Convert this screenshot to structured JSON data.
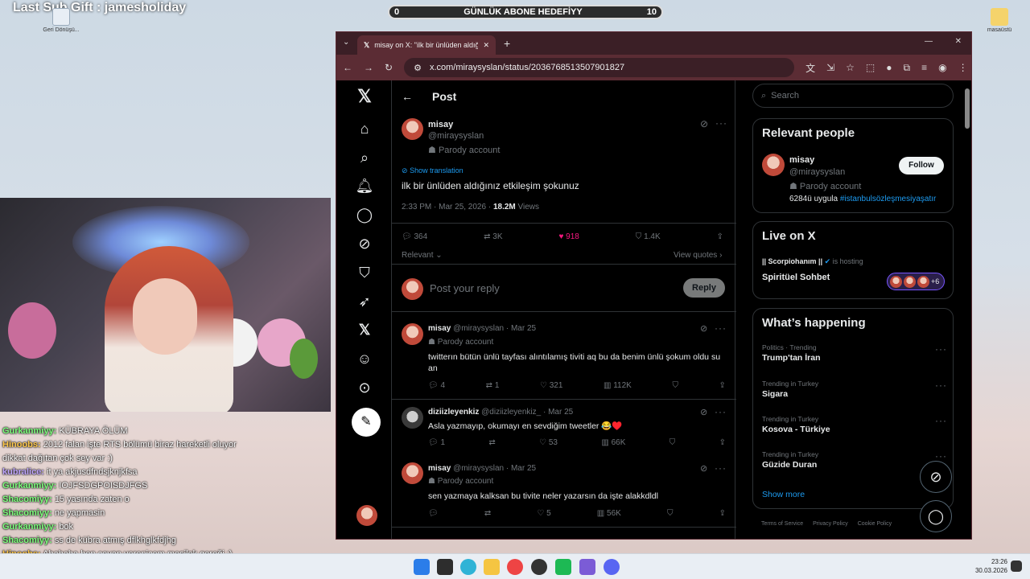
{
  "stream": {
    "last_sub_gift": "Last Sub Gift : jamesholiday",
    "goal": {
      "title": "GÜNLÜK ABONE HEDEFİYY",
      "current": "0",
      "target": "10",
      "progress": 0
    }
  },
  "desktop": {
    "recycle_label": "Geri Dönüşü...",
    "folder_label": "masaüstü"
  },
  "chat": [
    {
      "user": "Gurkanmiyy:",
      "msg": "KÜBRAYA ÖLÜM",
      "color": "#7dff7d"
    },
    {
      "user": "Hinoobs:",
      "msg": "2012 falan işte RTS bölümü biraz hareketli oluyor",
      "color": "#ffc94d"
    },
    {
      "user": "",
      "msg": "dikkat dağıtan çok sey var :)",
      "color": "#ffffff"
    },
    {
      "user": "kubralice:",
      "msg": "it ya akjusdfndsjknjkfsa",
      "color": "#c0a7ff"
    },
    {
      "user": "Gurkanmiyy:",
      "msg": "IOJFSDGPOISDJFGS",
      "color": "#7dff7d"
    },
    {
      "user": "Shacomiyy:",
      "msg": "15 yasında zaten o",
      "color": "#7dff7d"
    },
    {
      "user": "Shacomiyy:",
      "msg": "ne yapmasin",
      "color": "#7dff7d"
    },
    {
      "user": "Gurkanmiyy:",
      "msg": "bok",
      "color": "#7dff7d"
    },
    {
      "user": "Shacomiyy:",
      "msg": "ss de kübra atmış dflkhglkfdjhg",
      "color": "#7dff7d"
    },
    {
      "user": "Hinoobs:",
      "msg": "Ahahaha ben cevap verenicem mesilek gereği :)",
      "color": "#ffc94d"
    }
  ],
  "browser": {
    "tab_title": "misay on X: \"ilk bir ünlüden aldığı",
    "url": "x.com/miraysyslan/status/2036768513507901827"
  },
  "x": {
    "header_title": "Post",
    "post": {
      "name": "misay",
      "handle": "@miraysyslan",
      "parody": "Parody account",
      "show_translation": "Show translation",
      "text": "ilk bir ünlüden aldığınız etkileşim şokunuz",
      "time": "2:33 PM · Mar 25, 2026 · ",
      "views": "18.2M",
      "views_label": " Views",
      "replies": "364",
      "reposts": "3K",
      "likes": "918",
      "bookmarks": "1.4K",
      "relevant": "Relevant",
      "view_quotes": "View quotes"
    },
    "reply_placeholder": "Post your reply",
    "reply_button": "Reply",
    "replies": [
      {
        "name": "misay",
        "handle": "@miraysyslan · Mar 25",
        "parody": "Parody account",
        "text": "twitterın bütün ünlü tayfası alıntılamış tiviti aq bu da benim ünlü şokum oldu su an",
        "r": "4",
        "rt": "1",
        "l": "321",
        "v": "112K"
      },
      {
        "name": "diziizleyenkiz",
        "handle": "@diziizleyenkiz_ · Mar 25",
        "parody": "",
        "text": "Asla yazmayıp, okumayı en sevdiğim tweetler 😂♥️",
        "r": "1",
        "rt": "",
        "l": "53",
        "v": "66K"
      },
      {
        "name": "misay",
        "handle": "@miraysyslan · Mar 25",
        "parody": "Parody account",
        "text": "sen yazmaya kalksan bu tivite neler yazarsın da işte alakkdldl",
        "r": "",
        "rt": "",
        "l": "5",
        "v": "56K"
      }
    ],
    "search_placeholder": "Search",
    "relevant_people": {
      "title": "Relevant people",
      "name": "misay",
      "handle": "@miraysyslan",
      "parody": "Parody account",
      "bio": "6284ü uygula ",
      "bio_tag": "#istanbulsözleşmesiyaşatır",
      "follow": "Follow"
    },
    "live": {
      "title": "Live on X",
      "host": "|| Scorpiohanım ||",
      "hosting": " is hosting",
      "space": "Spiritüel Sohbet",
      "plus": "+6"
    },
    "happening": {
      "title": "What’s happening",
      "items": [
        {
          "meta": "Politics · Trending",
          "topic": "Trump'tan İran"
        },
        {
          "meta": "Trending in Turkey",
          "topic": "Sigara"
        },
        {
          "meta": "Trending in Turkey",
          "topic": "Kosova - Türkiye"
        },
        {
          "meta": "Trending in Turkey",
          "topic": "Güzide Duran"
        }
      ],
      "show_more": "Show more"
    },
    "footer": [
      "Terms of Service",
      "Privacy Policy",
      "Cookie Policy"
    ]
  },
  "taskbar": {
    "time": "23:26",
    "date": "30.03.2026"
  }
}
